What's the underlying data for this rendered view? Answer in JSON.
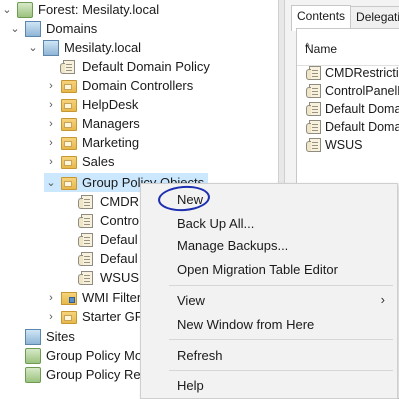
{
  "tree": {
    "forest": "Forest: Mesilaty.local",
    "domains": "Domains",
    "domain": "Mesilaty.local",
    "default_domain_policy": "Default Domain Policy",
    "ous": [
      "Domain Controllers",
      "HelpDesk",
      "Managers",
      "Marketing",
      "Sales"
    ],
    "group_policy_objects": "Group Policy Objects",
    "gpo_children": [
      "CMDR",
      "Contro",
      "Defaul",
      "Defaul",
      "WSUS"
    ],
    "wmi_filters": "WMI Filter",
    "starter_gpos": "Starter GP",
    "sites": "Sites",
    "gp_modeling": "Group Policy Mo",
    "gp_results": "Group Policy Res"
  },
  "right_pane": {
    "tabs": [
      "Contents",
      "Delegatio"
    ],
    "column_name": "Name",
    "items": [
      "CMDRestriction",
      "ControlPanelRe",
      "Default Domain",
      "Default Domain",
      "WSUS"
    ]
  },
  "context_menu": {
    "new": "New",
    "back_up_all": "Back Up All...",
    "manage_backups": "Manage Backups...",
    "open_migration": "Open Migration Table Editor",
    "view": "View",
    "new_window": "New Window from Here",
    "refresh": "Refresh",
    "help": "Help"
  }
}
